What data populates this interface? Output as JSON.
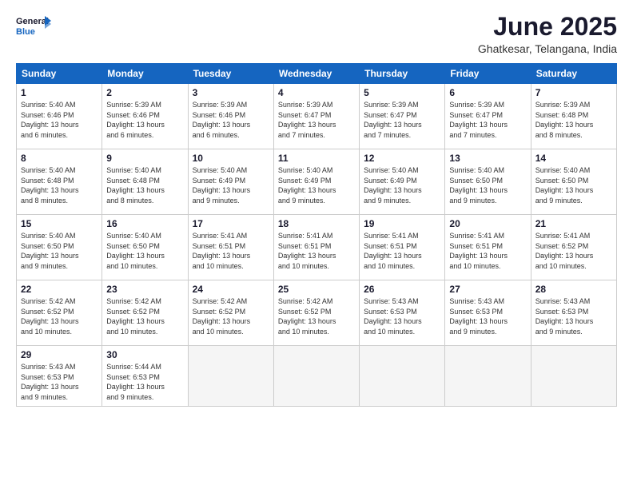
{
  "header": {
    "logo_general": "General",
    "logo_blue": "Blue",
    "month_title": "June 2025",
    "location": "Ghatkesar, Telangana, India"
  },
  "days_of_week": [
    "Sunday",
    "Monday",
    "Tuesday",
    "Wednesday",
    "Thursday",
    "Friday",
    "Saturday"
  ],
  "weeks": [
    [
      {
        "day": "1",
        "lines": [
          "Sunrise: 5:40 AM",
          "Sunset: 6:46 PM",
          "Daylight: 13 hours",
          "and 6 minutes."
        ]
      },
      {
        "day": "2",
        "lines": [
          "Sunrise: 5:39 AM",
          "Sunset: 6:46 PM",
          "Daylight: 13 hours",
          "and 6 minutes."
        ]
      },
      {
        "day": "3",
        "lines": [
          "Sunrise: 5:39 AM",
          "Sunset: 6:46 PM",
          "Daylight: 13 hours",
          "and 6 minutes."
        ]
      },
      {
        "day": "4",
        "lines": [
          "Sunrise: 5:39 AM",
          "Sunset: 6:47 PM",
          "Daylight: 13 hours",
          "and 7 minutes."
        ]
      },
      {
        "day": "5",
        "lines": [
          "Sunrise: 5:39 AM",
          "Sunset: 6:47 PM",
          "Daylight: 13 hours",
          "and 7 minutes."
        ]
      },
      {
        "day": "6",
        "lines": [
          "Sunrise: 5:39 AM",
          "Sunset: 6:47 PM",
          "Daylight: 13 hours",
          "and 7 minutes."
        ]
      },
      {
        "day": "7",
        "lines": [
          "Sunrise: 5:39 AM",
          "Sunset: 6:48 PM",
          "Daylight: 13 hours",
          "and 8 minutes."
        ]
      }
    ],
    [
      {
        "day": "8",
        "lines": [
          "Sunrise: 5:40 AM",
          "Sunset: 6:48 PM",
          "Daylight: 13 hours",
          "and 8 minutes."
        ]
      },
      {
        "day": "9",
        "lines": [
          "Sunrise: 5:40 AM",
          "Sunset: 6:48 PM",
          "Daylight: 13 hours",
          "and 8 minutes."
        ]
      },
      {
        "day": "10",
        "lines": [
          "Sunrise: 5:40 AM",
          "Sunset: 6:49 PM",
          "Daylight: 13 hours",
          "and 9 minutes."
        ]
      },
      {
        "day": "11",
        "lines": [
          "Sunrise: 5:40 AM",
          "Sunset: 6:49 PM",
          "Daylight: 13 hours",
          "and 9 minutes."
        ]
      },
      {
        "day": "12",
        "lines": [
          "Sunrise: 5:40 AM",
          "Sunset: 6:49 PM",
          "Daylight: 13 hours",
          "and 9 minutes."
        ]
      },
      {
        "day": "13",
        "lines": [
          "Sunrise: 5:40 AM",
          "Sunset: 6:50 PM",
          "Daylight: 13 hours",
          "and 9 minutes."
        ]
      },
      {
        "day": "14",
        "lines": [
          "Sunrise: 5:40 AM",
          "Sunset: 6:50 PM",
          "Daylight: 13 hours",
          "and 9 minutes."
        ]
      }
    ],
    [
      {
        "day": "15",
        "lines": [
          "Sunrise: 5:40 AM",
          "Sunset: 6:50 PM",
          "Daylight: 13 hours",
          "and 9 minutes."
        ]
      },
      {
        "day": "16",
        "lines": [
          "Sunrise: 5:40 AM",
          "Sunset: 6:50 PM",
          "Daylight: 13 hours",
          "and 10 minutes."
        ]
      },
      {
        "day": "17",
        "lines": [
          "Sunrise: 5:41 AM",
          "Sunset: 6:51 PM",
          "Daylight: 13 hours",
          "and 10 minutes."
        ]
      },
      {
        "day": "18",
        "lines": [
          "Sunrise: 5:41 AM",
          "Sunset: 6:51 PM",
          "Daylight: 13 hours",
          "and 10 minutes."
        ]
      },
      {
        "day": "19",
        "lines": [
          "Sunrise: 5:41 AM",
          "Sunset: 6:51 PM",
          "Daylight: 13 hours",
          "and 10 minutes."
        ]
      },
      {
        "day": "20",
        "lines": [
          "Sunrise: 5:41 AM",
          "Sunset: 6:51 PM",
          "Daylight: 13 hours",
          "and 10 minutes."
        ]
      },
      {
        "day": "21",
        "lines": [
          "Sunrise: 5:41 AM",
          "Sunset: 6:52 PM",
          "Daylight: 13 hours",
          "and 10 minutes."
        ]
      }
    ],
    [
      {
        "day": "22",
        "lines": [
          "Sunrise: 5:42 AM",
          "Sunset: 6:52 PM",
          "Daylight: 13 hours",
          "and 10 minutes."
        ]
      },
      {
        "day": "23",
        "lines": [
          "Sunrise: 5:42 AM",
          "Sunset: 6:52 PM",
          "Daylight: 13 hours",
          "and 10 minutes."
        ]
      },
      {
        "day": "24",
        "lines": [
          "Sunrise: 5:42 AM",
          "Sunset: 6:52 PM",
          "Daylight: 13 hours",
          "and 10 minutes."
        ]
      },
      {
        "day": "25",
        "lines": [
          "Sunrise: 5:42 AM",
          "Sunset: 6:52 PM",
          "Daylight: 13 hours",
          "and 10 minutes."
        ]
      },
      {
        "day": "26",
        "lines": [
          "Sunrise: 5:43 AM",
          "Sunset: 6:53 PM",
          "Daylight: 13 hours",
          "and 10 minutes."
        ]
      },
      {
        "day": "27",
        "lines": [
          "Sunrise: 5:43 AM",
          "Sunset: 6:53 PM",
          "Daylight: 13 hours",
          "and 9 minutes."
        ]
      },
      {
        "day": "28",
        "lines": [
          "Sunrise: 5:43 AM",
          "Sunset: 6:53 PM",
          "Daylight: 13 hours",
          "and 9 minutes."
        ]
      }
    ],
    [
      {
        "day": "29",
        "lines": [
          "Sunrise: 5:43 AM",
          "Sunset: 6:53 PM",
          "Daylight: 13 hours",
          "and 9 minutes."
        ]
      },
      {
        "day": "30",
        "lines": [
          "Sunrise: 5:44 AM",
          "Sunset: 6:53 PM",
          "Daylight: 13 hours",
          "and 9 minutes."
        ]
      },
      null,
      null,
      null,
      null,
      null
    ]
  ]
}
